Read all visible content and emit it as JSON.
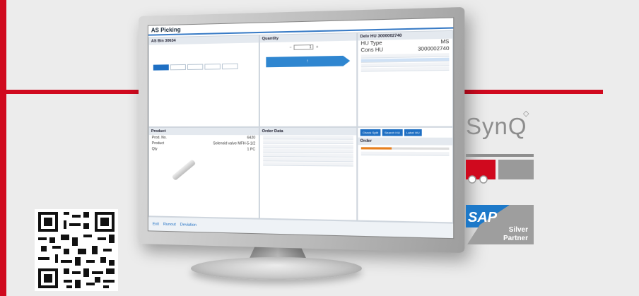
{
  "screen": {
    "app_title": "AS Picking",
    "bin_panel": {
      "title": "AS Bin 30634",
      "slots": [
        "",
        "",
        "",
        "",
        ""
      ]
    },
    "qty_panel": {
      "title": "Quantity",
      "qty": "1",
      "arrow_label": "↑"
    },
    "delivery_panel": {
      "title": "Delv HU 3000002740",
      "hu_type_label": "HU Type",
      "hu_type_value": "MS",
      "cons_label": "Cons HU",
      "cons_value": "3000002740"
    },
    "delivery_buttons": [
      "Check Split",
      "Search HU",
      "Label HU"
    ],
    "order_panel": {
      "title": "Order"
    },
    "product_panel": {
      "title": "Product",
      "prod_no_label": "Prod. No.",
      "prod_no_value": "6420",
      "product_label": "Product",
      "product_value": "Solenoid valve MFH-5-1/2",
      "qty_label": "Qty",
      "qty_value": "1 PC"
    },
    "order_data_panel": {
      "title": "Order Data"
    },
    "footer": {
      "exit": "Exit",
      "runout": "Runout",
      "deviation": "Deviation",
      "page": ""
    }
  },
  "logos": {
    "synq": "SynQ",
    "sap_silver": "Silver",
    "sap_partner": "Partner"
  },
  "colors": {
    "brand_red": "#d0091e",
    "screen_blue": "#1e6fc3"
  }
}
